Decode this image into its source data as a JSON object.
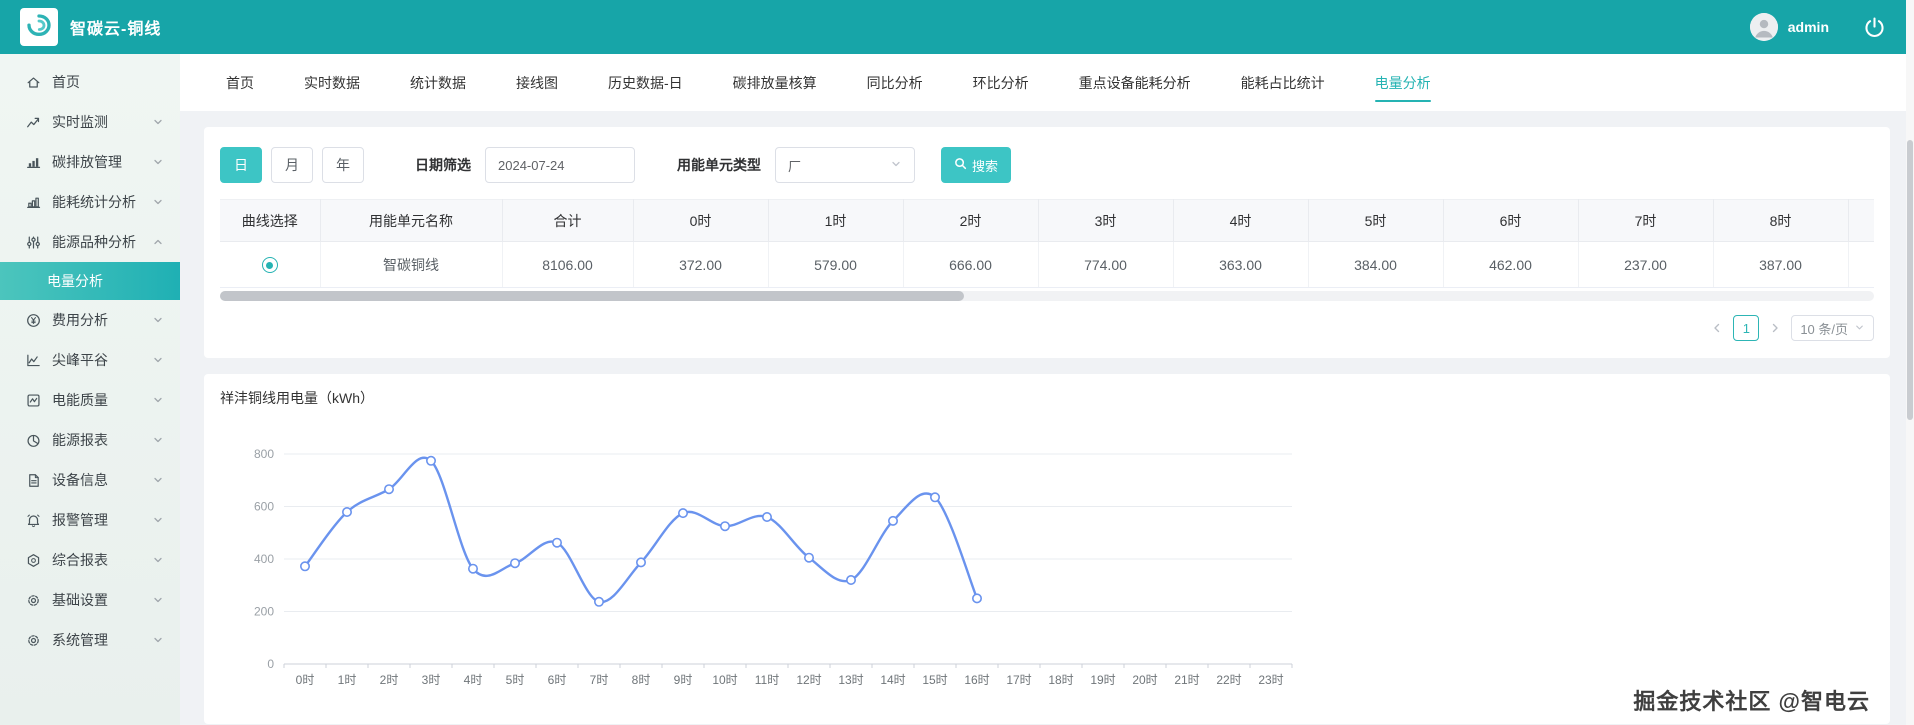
{
  "colors": {
    "header_teal": "#17a5a8",
    "accent_teal": "#2db5b5",
    "button_teal": "#3dc5c5",
    "chart_line_blue": "#6a93ee"
  },
  "brand": {
    "title": "智碳云-铜线"
  },
  "header": {
    "username": "admin"
  },
  "sidebar": {
    "items": [
      {
        "label": "首页",
        "icon": "home",
        "expandable": false
      },
      {
        "label": "实时监测",
        "icon": "trend",
        "expandable": true
      },
      {
        "label": "碳排放管理",
        "icon": "bar-chart",
        "expandable": true
      },
      {
        "label": "能耗统计分析",
        "icon": "column-chart",
        "expandable": true
      },
      {
        "label": "能源品种分析",
        "icon": "sliders",
        "expandable": true,
        "expanded": true
      },
      {
        "label": "电量分析",
        "submenu": true,
        "active": true
      },
      {
        "label": "费用分析",
        "icon": "yen-circle",
        "expandable": true
      },
      {
        "label": "尖峰平谷",
        "icon": "peak-line",
        "expandable": true
      },
      {
        "label": "电能质量",
        "icon": "quality-square",
        "expandable": true
      },
      {
        "label": "能源报表",
        "icon": "pie",
        "expandable": true
      },
      {
        "label": "设备信息",
        "icon": "doc",
        "expandable": true
      },
      {
        "label": "报警管理",
        "icon": "alarm",
        "expandable": true
      },
      {
        "label": "综合报表",
        "icon": "report",
        "expandable": true
      },
      {
        "label": "基础设置",
        "icon": "gear",
        "expandable": true
      },
      {
        "label": "系统管理",
        "icon": "gear",
        "expandable": true
      }
    ]
  },
  "tabs": {
    "items": [
      {
        "label": "首页"
      },
      {
        "label": "实时数据"
      },
      {
        "label": "统计数据"
      },
      {
        "label": "接线图"
      },
      {
        "label": "历史数据-日"
      },
      {
        "label": "碳排放量核算"
      },
      {
        "label": "同比分析"
      },
      {
        "label": "环比分析"
      },
      {
        "label": "重点设备能耗分析"
      },
      {
        "label": "能耗占比统计"
      },
      {
        "label": "电量分析",
        "active": true
      }
    ]
  },
  "filters": {
    "period_buttons": [
      {
        "label": "日",
        "active": true
      },
      {
        "label": "月",
        "active": false
      },
      {
        "label": "年",
        "active": false
      }
    ],
    "date_label": "日期筛选",
    "date_value": "2024-07-24",
    "unit_type_label": "用能单元类型",
    "unit_type_value": "厂",
    "search_label": "搜索"
  },
  "table": {
    "headers": [
      "曲线选择",
      "用能单元名称",
      "合计",
      "0时",
      "1时",
      "2时",
      "3时",
      "4时",
      "5时",
      "6时",
      "7时",
      "8时"
    ],
    "rows": [
      {
        "name": "智碳铜线",
        "selected": true,
        "values": [
          "8106.00",
          "372.00",
          "579.00",
          "666.00",
          "774.00",
          "363.00",
          "384.00",
          "462.00",
          "237.00",
          "387.00"
        ]
      }
    ]
  },
  "pagination": {
    "page": "1",
    "page_size": "10 条/页"
  },
  "chart_data": {
    "type": "line",
    "title": "祥沣铜线用电量（kWh）",
    "x": [
      "0时",
      "1时",
      "2时",
      "3时",
      "4时",
      "5时",
      "6时",
      "7时",
      "8时",
      "9时",
      "10时",
      "11时",
      "12时",
      "13时",
      "14时",
      "15时",
      "16时",
      "17时",
      "18时",
      "19时",
      "20时",
      "21时",
      "22时",
      "23时"
    ],
    "series": [
      {
        "name": "用电量",
        "values": [
          372,
          579,
          666,
          774,
          363,
          384,
          462,
          237,
          387,
          575,
          525,
          560,
          405,
          320,
          545,
          635,
          250,
          null,
          null,
          null,
          null,
          null,
          null,
          null
        ]
      }
    ],
    "ylim": [
      0,
      800
    ],
    "yticks": [
      0,
      200,
      400,
      600,
      800
    ],
    "grid": true,
    "smooth": true,
    "legend_position": "none",
    "line_color": "#6a93ee"
  },
  "watermark": "掘金技术社区 @智电云"
}
